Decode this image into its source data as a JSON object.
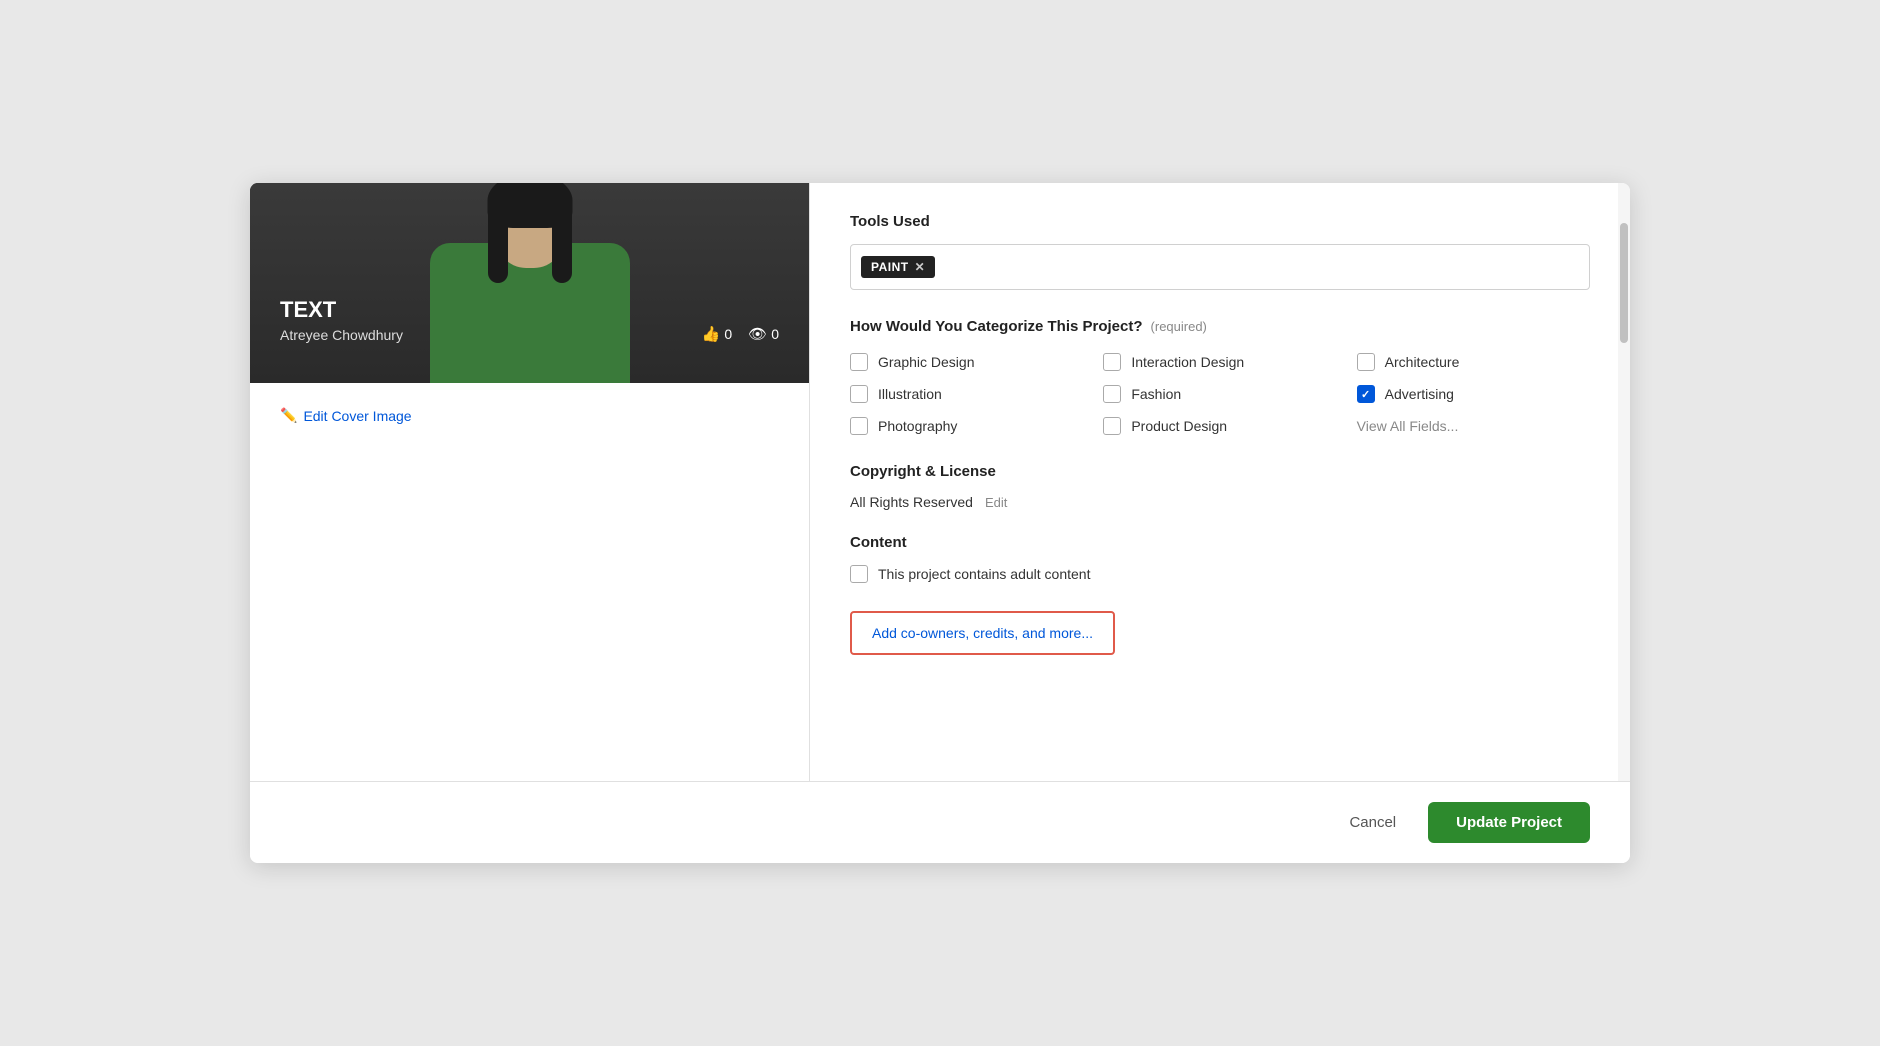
{
  "modal": {
    "cover": {
      "project_label": "TEXT",
      "author_name": "Atreyee Chowdhury",
      "likes_count": "0",
      "views_count": "0",
      "edit_cover_label": "Edit Cover Image"
    },
    "tools_section": {
      "title": "Tools Used",
      "tags": [
        {
          "id": "paint",
          "label": "PAINT"
        }
      ]
    },
    "categorize_section": {
      "title": "How Would You Categorize This Project?",
      "required_label": "(required)",
      "categories": [
        {
          "id": "graphic-design",
          "label": "Graphic Design",
          "checked": false
        },
        {
          "id": "interaction-design",
          "label": "Interaction Design",
          "checked": false
        },
        {
          "id": "architecture",
          "label": "Architecture",
          "checked": false
        },
        {
          "id": "illustration",
          "label": "Illustration",
          "checked": false
        },
        {
          "id": "fashion",
          "label": "Fashion",
          "checked": false
        },
        {
          "id": "advertising",
          "label": "Advertising",
          "checked": true
        },
        {
          "id": "photography",
          "label": "Photography",
          "checked": false
        },
        {
          "id": "product-design",
          "label": "Product Design",
          "checked": false
        }
      ],
      "view_all_label": "View All Fields..."
    },
    "copyright_section": {
      "title": "Copyright & License",
      "value": "All Rights Reserved",
      "edit_label": "Edit"
    },
    "content_section": {
      "title": "Content",
      "adult_content_label": "This project contains adult content"
    },
    "add_more_label": "Add co-owners, credits, and more...",
    "footer": {
      "cancel_label": "Cancel",
      "update_label": "Update Project"
    }
  }
}
